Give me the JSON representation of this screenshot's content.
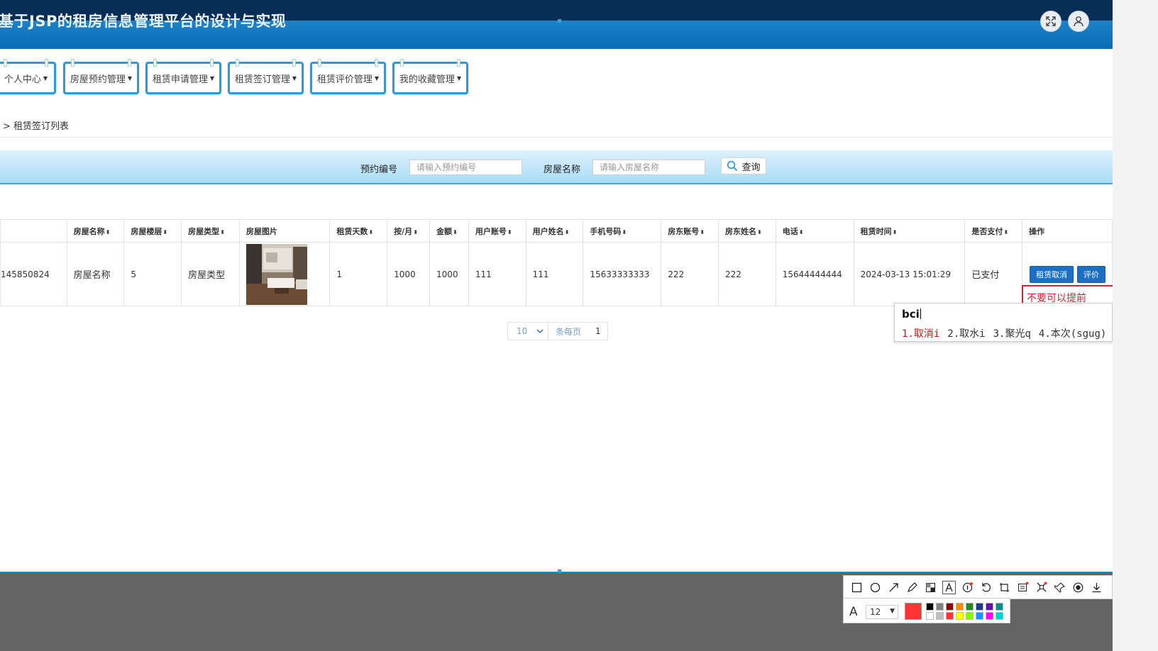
{
  "header": {
    "title": "基于JSP的租房信息管理平台的设计与实现"
  },
  "nav": [
    {
      "label": "个人中心"
    },
    {
      "label": "房屋预约管理"
    },
    {
      "label": "租赁申请管理"
    },
    {
      "label": "租赁签订管理"
    },
    {
      "label": "租赁评价管理"
    },
    {
      "label": "我的收藏管理"
    }
  ],
  "breadcrumb": "> 租赁签订列表",
  "search": {
    "field1_label": "预约编号",
    "field1_placeholder": "请输入预约编号",
    "field2_label": "房屋名称",
    "field2_placeholder": "请输入房屋名称",
    "button_label": "查询"
  },
  "table": {
    "headers": [
      "",
      "房屋名称",
      "房屋楼层",
      "房屋类型",
      "房屋图片",
      "租赁天数",
      "按/月",
      "金额",
      "用户账号",
      "用户姓名",
      "手机号码",
      "房东账号",
      "房东姓名",
      "电话",
      "租赁时间",
      "是否支付",
      "操作"
    ],
    "rows": [
      {
        "cells": [
          "145850824",
          "房屋名称",
          "5",
          "房屋类型",
          "",
          "1",
          "1000",
          "1000",
          "111",
          "111",
          "15633333333",
          "222",
          "222",
          "15644444444",
          "2024-03-13 15:01:29",
          "已支付"
        ],
        "actions": {
          "cancel": "租赁取消",
          "review": "评价"
        }
      }
    ]
  },
  "pager": {
    "page_size": "10",
    "per_page_label": "条每页",
    "page": "1"
  },
  "tooltip": "不要可以提前",
  "ime": {
    "input": "bci",
    "candidates": [
      "1.取消i",
      "2.取水i",
      "3.聚光q",
      "4.本次(sgug)"
    ]
  },
  "annotation": {
    "font_size": "12",
    "current_color": "#ff3333",
    "palette": [
      "#000000",
      "#808080",
      "#8b0000",
      "#ff8c00",
      "#228b22",
      "#1e3a8a",
      "#6a0dad",
      "#008b8b",
      "#ffffff",
      "#c0c0c0",
      "#ff3333",
      "#ffff00",
      "#7cfc00",
      "#1e90ff",
      "#ff00ff",
      "#00ced1"
    ],
    "tools": [
      "rectangle-icon",
      "ellipse-icon",
      "arrow-icon",
      "pencil-icon",
      "mosaic-icon",
      "text-icon",
      "number-icon",
      "undo-icon",
      "crop-icon",
      "ocr-icon",
      "pin-icon",
      "pin2-icon",
      "record-icon",
      "download-icon"
    ]
  }
}
